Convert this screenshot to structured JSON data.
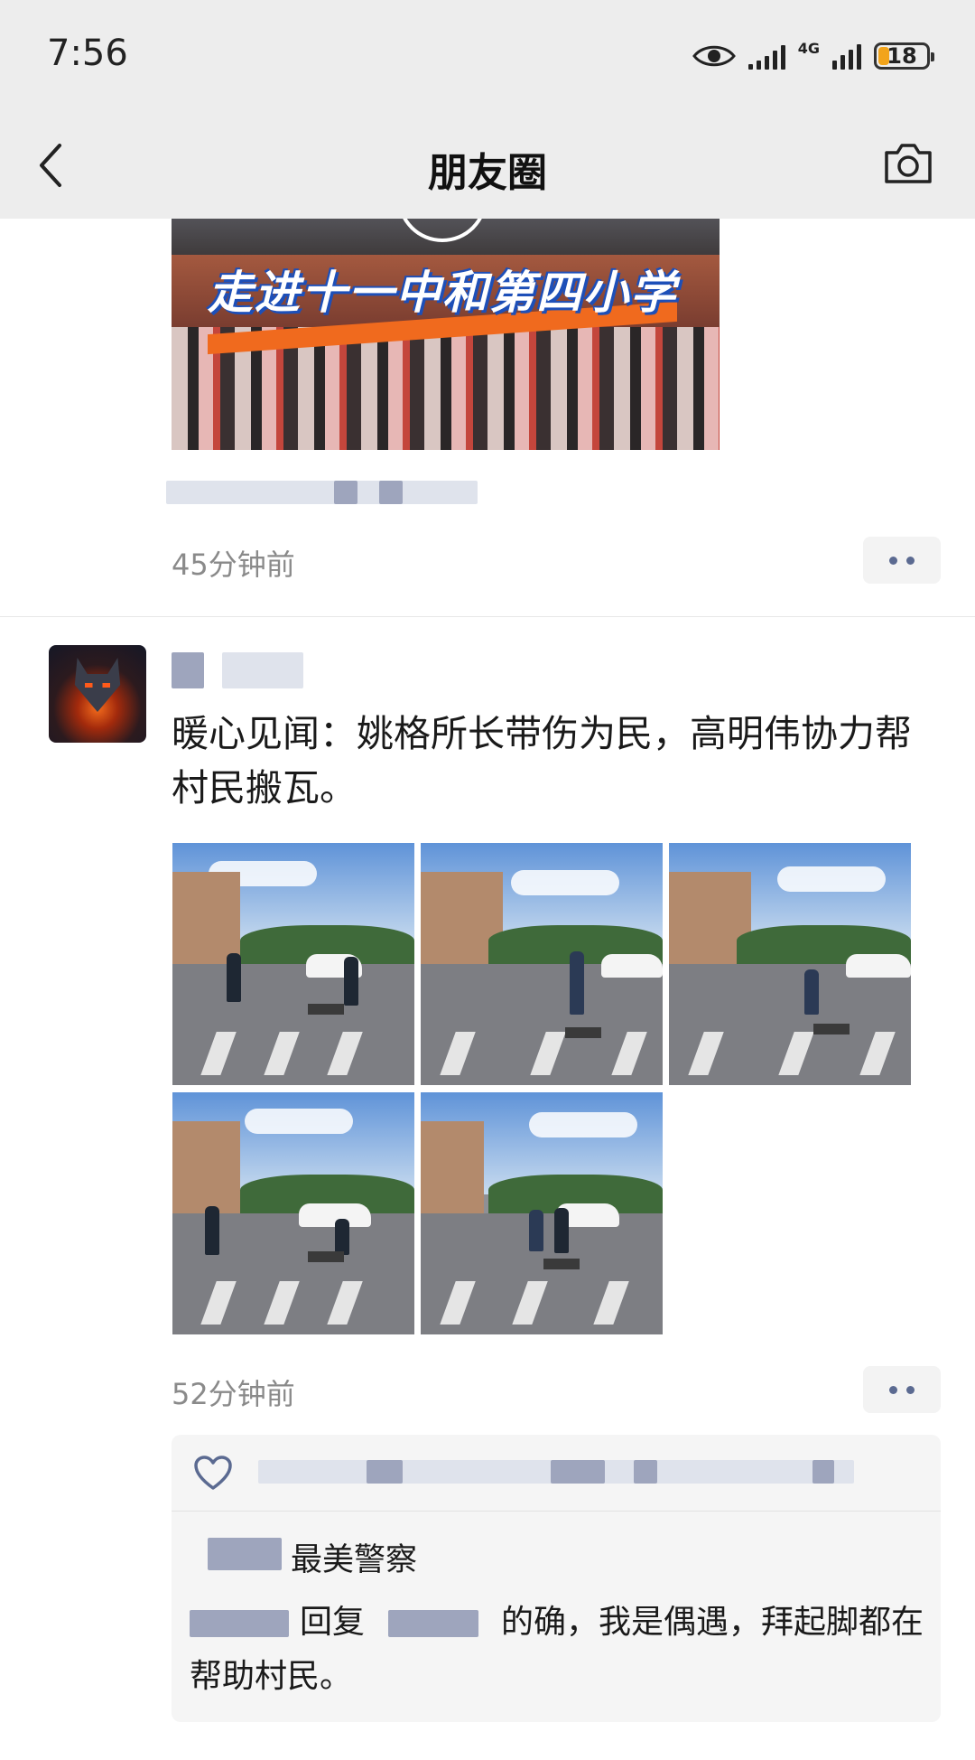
{
  "status_bar": {
    "time": "7:56",
    "network": "4G",
    "battery": "18"
  },
  "nav": {
    "title": "朋友圈",
    "back_icon": "chevron-left-icon",
    "camera_icon": "camera-icon"
  },
  "post1": {
    "video_caption": "走进十一中和第四小学",
    "time_ago": "45分钟前"
  },
  "post2": {
    "text": "暖心见闻：姚格所长带伤为民，高明伟协力帮村民搬瓦。",
    "photo_count": 5,
    "time_ago": "52分钟前",
    "comments": {
      "comment1_text": "最美警察",
      "reply_word": "回复",
      "comment2_text": "的确，我是偶遇，拜起脚都在帮助村民。"
    }
  }
}
